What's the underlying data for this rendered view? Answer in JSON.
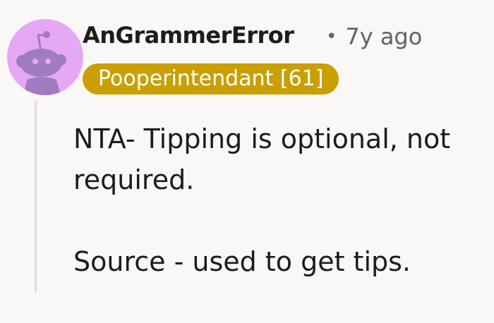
{
  "comment": {
    "author": "AnGrammerError",
    "separator": "•",
    "age": "7y ago",
    "flair": "Pooperintendant [61]",
    "paragraphs": [
      "NTA- Tipping is optional, not required.",
      "Source - used to get tips."
    ]
  },
  "avatar": {
    "icon": "snoo-avatar-icon",
    "background_color": "#e5a8f4",
    "figure_color": "#a07cc0"
  },
  "colors": {
    "flair_background": "#c9a000",
    "flair_text": "#ffffff",
    "thread_line": "#e6ddd6",
    "meta_text": "#5f6368"
  }
}
